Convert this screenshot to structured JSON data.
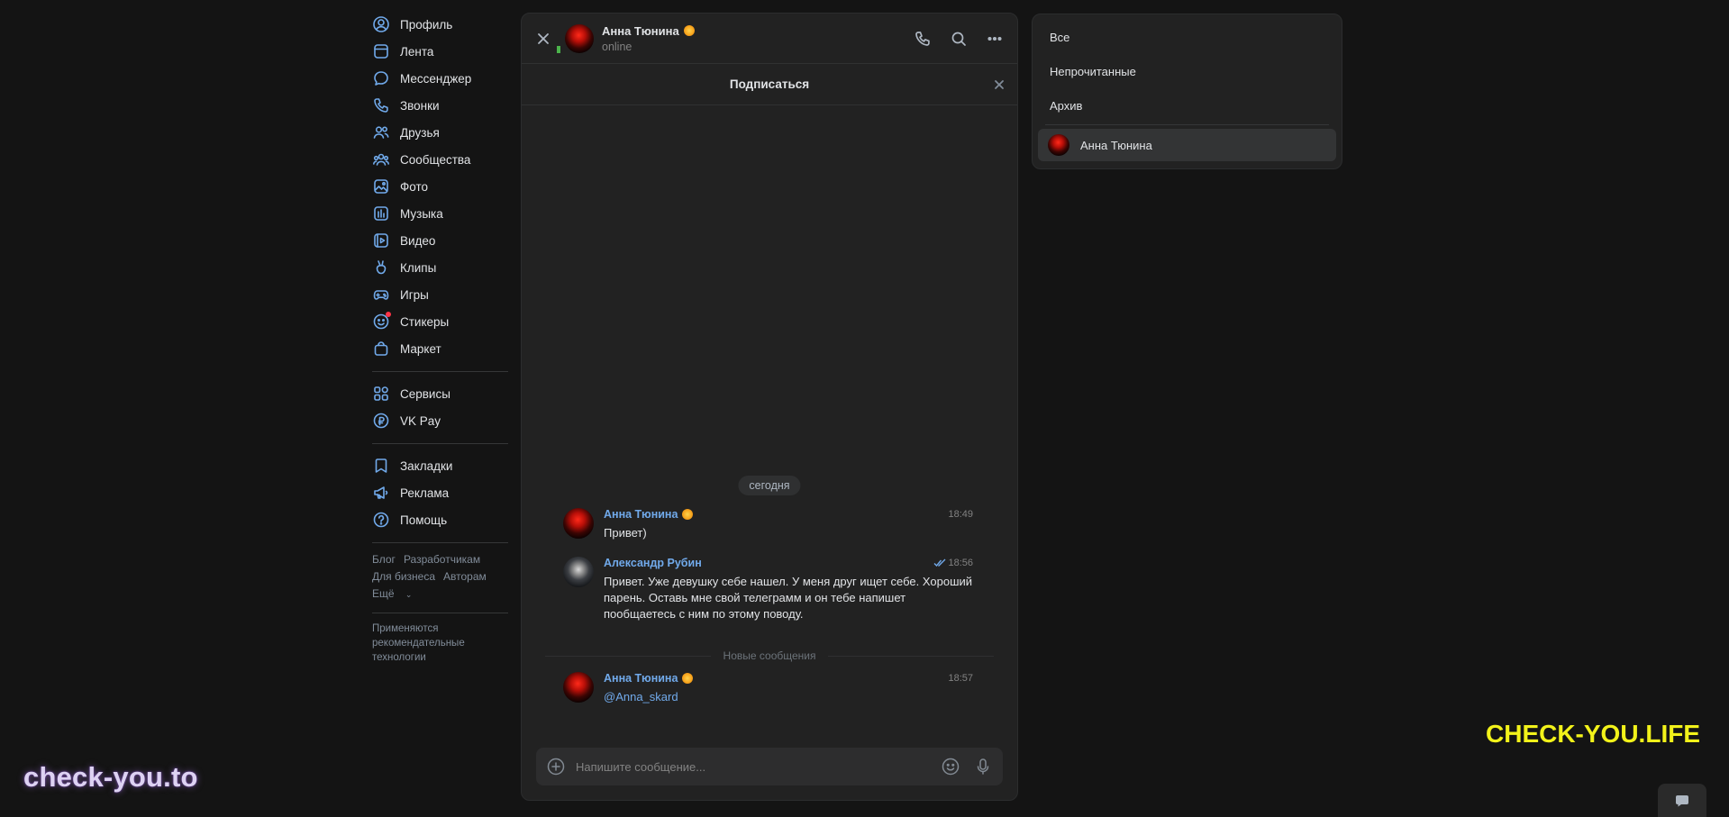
{
  "nav": {
    "items": [
      {
        "label": "Профиль",
        "icon": "user-circle-icon"
      },
      {
        "label": "Лента",
        "icon": "newsfeed-icon"
      },
      {
        "label": "Мессенджер",
        "icon": "message-icon"
      },
      {
        "label": "Звонки",
        "icon": "phone-icon"
      },
      {
        "label": "Друзья",
        "icon": "friends-icon"
      },
      {
        "label": "Сообщества",
        "icon": "communities-icon"
      },
      {
        "label": "Фото",
        "icon": "photo-icon"
      },
      {
        "label": "Музыка",
        "icon": "music-icon"
      },
      {
        "label": "Видео",
        "icon": "video-icon"
      },
      {
        "label": "Клипы",
        "icon": "clips-icon"
      },
      {
        "label": "Игры",
        "icon": "gamepad-icon"
      },
      {
        "label": "Стикеры",
        "icon": "sticker-icon"
      },
      {
        "label": "Маркет",
        "icon": "market-bag-icon"
      }
    ],
    "services": [
      {
        "label": "Сервисы",
        "icon": "services-grid-icon"
      },
      {
        "label": "VK Pay",
        "icon": "vkpay-icon"
      }
    ],
    "misc": [
      {
        "label": "Закладки",
        "icon": "bookmark-icon"
      },
      {
        "label": "Реклама",
        "icon": "megaphone-icon"
      },
      {
        "label": "Помощь",
        "icon": "help-icon"
      }
    ],
    "footer_links": [
      "Блог",
      "Разработчикам",
      "Для бизнеса",
      "Авторам"
    ],
    "more_label": "Ещё",
    "disclaimer": "Применяются рекомендательные технологии"
  },
  "chat": {
    "contact_name": "Анна Тюнина",
    "status": "online",
    "subscribe_label": "Подписаться",
    "date_label": "сегодня",
    "messages": [
      {
        "author": "Анна Тюнина",
        "time": "18:49",
        "text": "Привет)"
      },
      {
        "author": "Александр Рубин",
        "time": "18:56",
        "text": "Привет. Уже девушку себе нашел. У меня друг ищет себе. Хороший парень. Оставь мне свой телеграмм и он тебе напишет пообщаетесь с ним по этому поводу."
      },
      {
        "author": "Анна Тюнина",
        "time": "18:57",
        "text": "@Anna_skard"
      }
    ],
    "new_messages_label": "Новые сообщения",
    "composer_placeholder": "Напишите сообщение..."
  },
  "filters": {
    "items": [
      "Все",
      "Непрочитанные",
      "Архив"
    ],
    "chat_entry": "Анна Тюнина"
  },
  "watermarks": {
    "left": "check-you.to",
    "right": "CHECK-YOU.LIFE"
  },
  "colors": {
    "background": "#141414",
    "panel": "#222222",
    "accent": "#71aaeb",
    "online": "#4bb34b",
    "watermark_yellow": "#f2f21a"
  }
}
